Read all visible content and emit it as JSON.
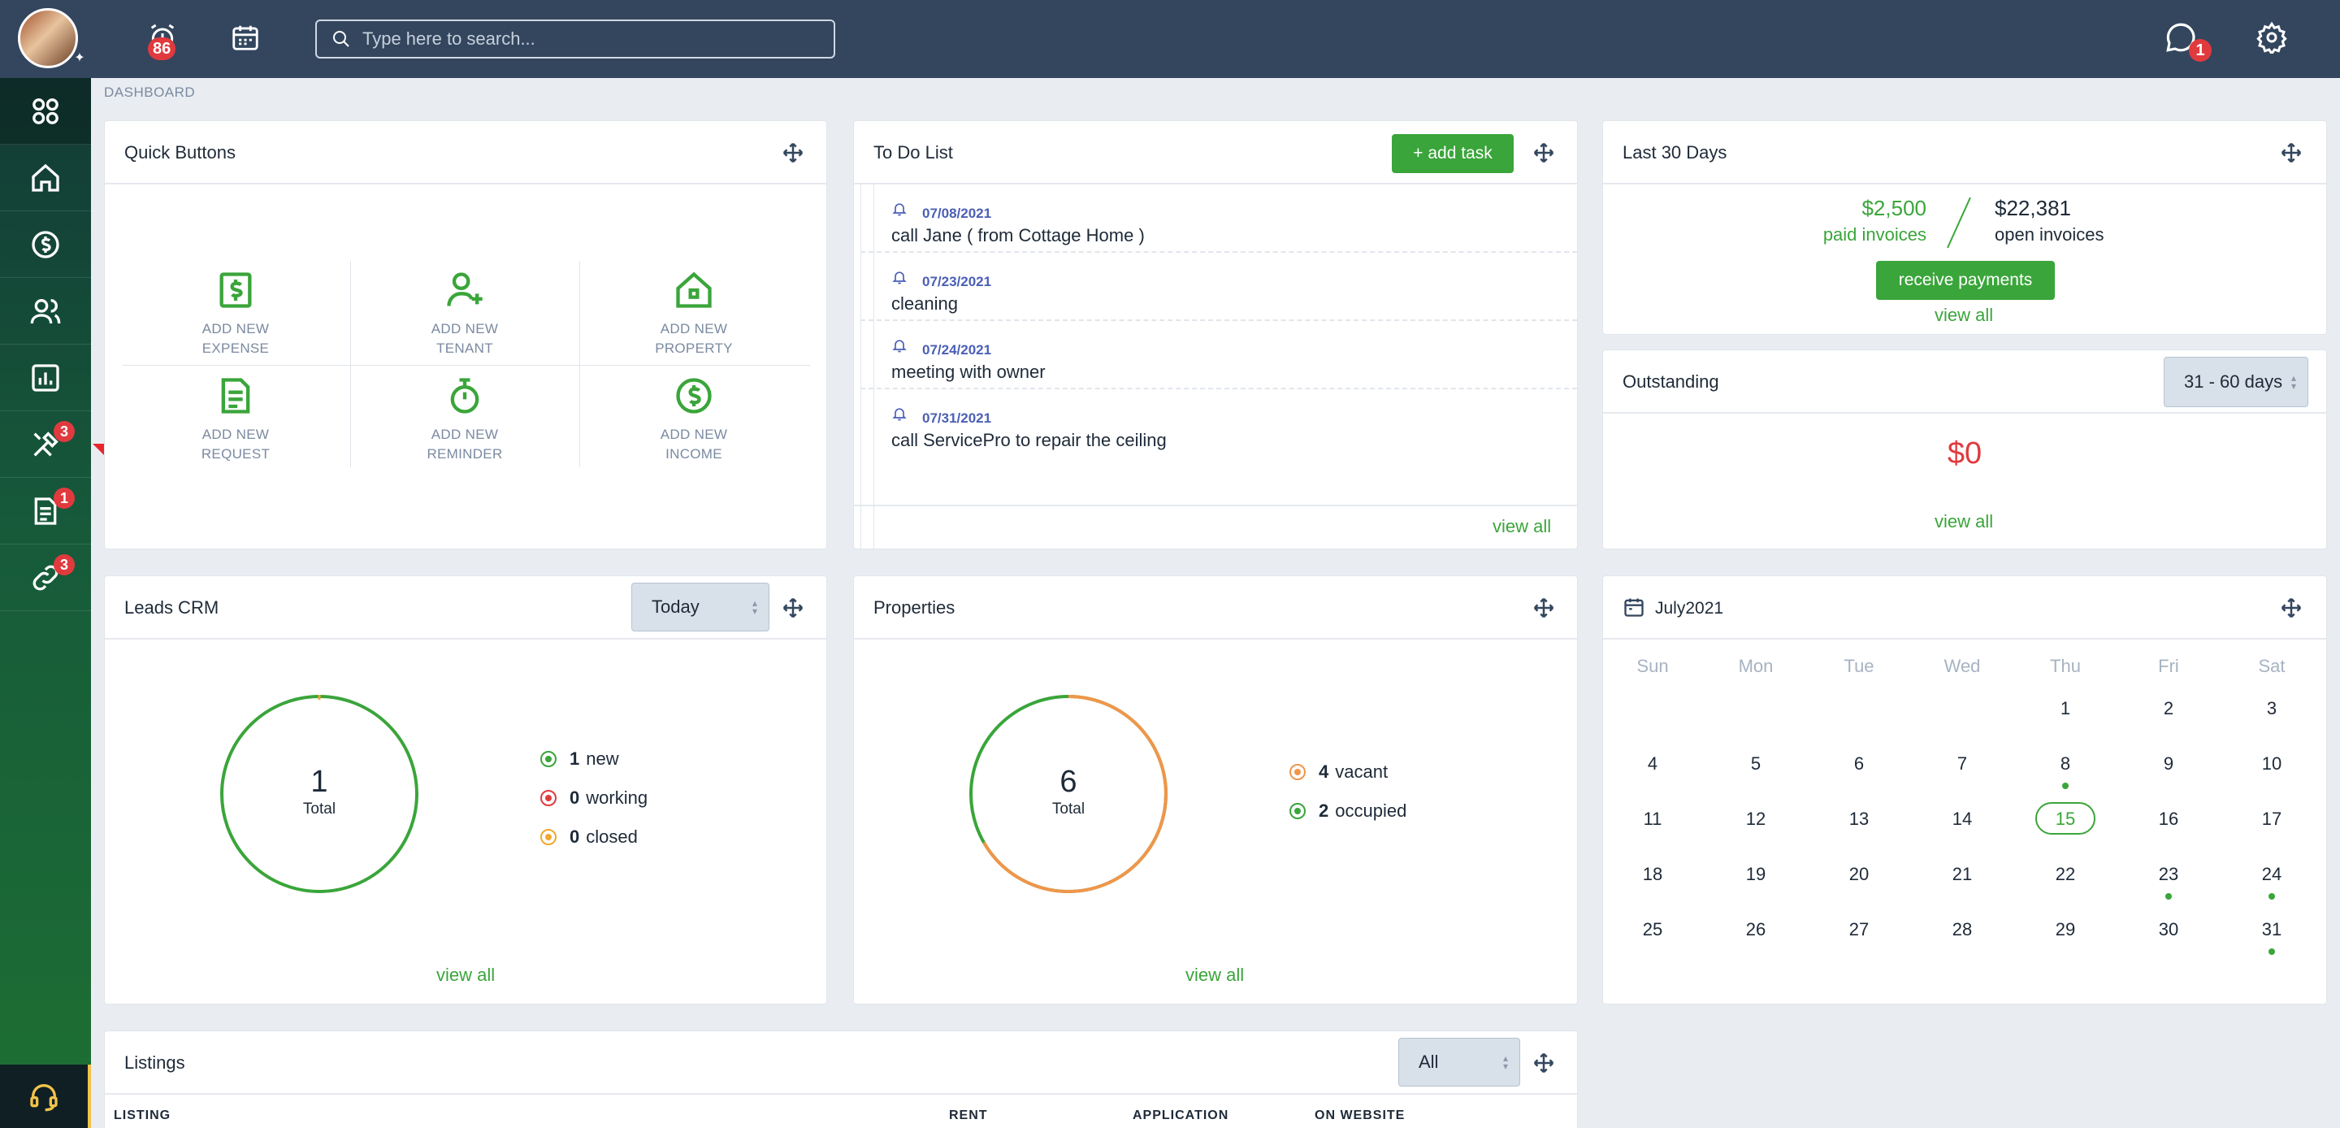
{
  "topbar": {
    "alarm_count": "86",
    "search_placeholder": "Type here to search...",
    "messages_count": "1"
  },
  "sidebar": {
    "items": [
      {
        "name": "dashboard",
        "icon": "grid-icon"
      },
      {
        "name": "home",
        "icon": "home-icon"
      },
      {
        "name": "payments",
        "icon": "dollar-icon"
      },
      {
        "name": "people",
        "icon": "users-icon"
      },
      {
        "name": "reports",
        "icon": "chart-icon"
      },
      {
        "name": "maintenance",
        "icon": "tools-icon",
        "badge": "3"
      },
      {
        "name": "documents",
        "icon": "document-icon",
        "badge": "1"
      },
      {
        "name": "links",
        "icon": "link-icon",
        "badge": "3"
      }
    ],
    "support_icon": "headset-icon"
  },
  "breadcrumb": "DASHBOARD",
  "quick_buttons": {
    "title": "Quick Buttons",
    "items": [
      {
        "line1": "ADD NEW",
        "line2": "EXPENSE",
        "icon": "dollar-file-icon"
      },
      {
        "line1": "ADD NEW",
        "line2": "TENANT",
        "icon": "add-user-icon"
      },
      {
        "line1": "ADD NEW",
        "line2": "PROPERTY",
        "icon": "house-icon"
      },
      {
        "line1": "ADD NEW",
        "line2": "REQUEST",
        "icon": "document-icon"
      },
      {
        "line1": "ADD NEW",
        "line2": "REMINDER",
        "icon": "stopwatch-icon"
      },
      {
        "line1": "ADD NEW",
        "line2": "INCOME",
        "icon": "dollar-circle-icon"
      }
    ]
  },
  "todo": {
    "title": "To Do List",
    "add_label": "+ add task",
    "items": [
      {
        "date": "07/08/2021",
        "text": "call Jane ( from Cottage Home )"
      },
      {
        "date": "07/23/2021",
        "text": "cleaning"
      },
      {
        "date": "07/24/2021",
        "text": "meeting with owner"
      },
      {
        "date": "07/31/2021",
        "text": "call ServicePro to repair the ceiling"
      }
    ],
    "view_all": "view all"
  },
  "last30": {
    "title": "Last 30 Days",
    "paid_amount": "$2,500",
    "paid_label": "paid invoices",
    "open_amount": "$22,381",
    "open_label": "open invoices",
    "button": "receive payments",
    "view_all": "view all"
  },
  "outstanding": {
    "title": "Outstanding",
    "range": "31 - 60 days",
    "amount": "$0",
    "view_all": "view all"
  },
  "leads": {
    "title": "Leads CRM",
    "period": "Today",
    "total": "1",
    "total_label": "Total",
    "legend": [
      {
        "count": "1",
        "label": "new",
        "color": "#3aa53a"
      },
      {
        "count": "0",
        "label": "working",
        "color": "#e03a3e"
      },
      {
        "count": "0",
        "label": "closed",
        "color": "#f0a830"
      }
    ],
    "view_all": "view all"
  },
  "properties": {
    "title": "Properties",
    "total": "6",
    "total_label": "Total",
    "vacant_fraction": 0.667,
    "legend": [
      {
        "count": "4",
        "label": "vacant",
        "color": "#f0964a"
      },
      {
        "count": "2",
        "label": "occupied",
        "color": "#3aa53a"
      }
    ],
    "view_all": "view all"
  },
  "calendar": {
    "title": "July2021",
    "weekdays": [
      "Sun",
      "Mon",
      "Tue",
      "Wed",
      "Thu",
      "Fri",
      "Sat"
    ],
    "first_weekday": 4,
    "days_in_month": 31,
    "today": 15,
    "event_days": [
      8,
      23,
      24,
      31
    ]
  },
  "listings": {
    "title": "Listings",
    "filter": "All",
    "columns": [
      "LISTING",
      "RENT",
      "APPLICATION",
      "ON WEBSITE"
    ]
  },
  "colors": {
    "brand_green": "#3aa53a",
    "topbar": "#33465e",
    "alert_red": "#e03a3e"
  }
}
